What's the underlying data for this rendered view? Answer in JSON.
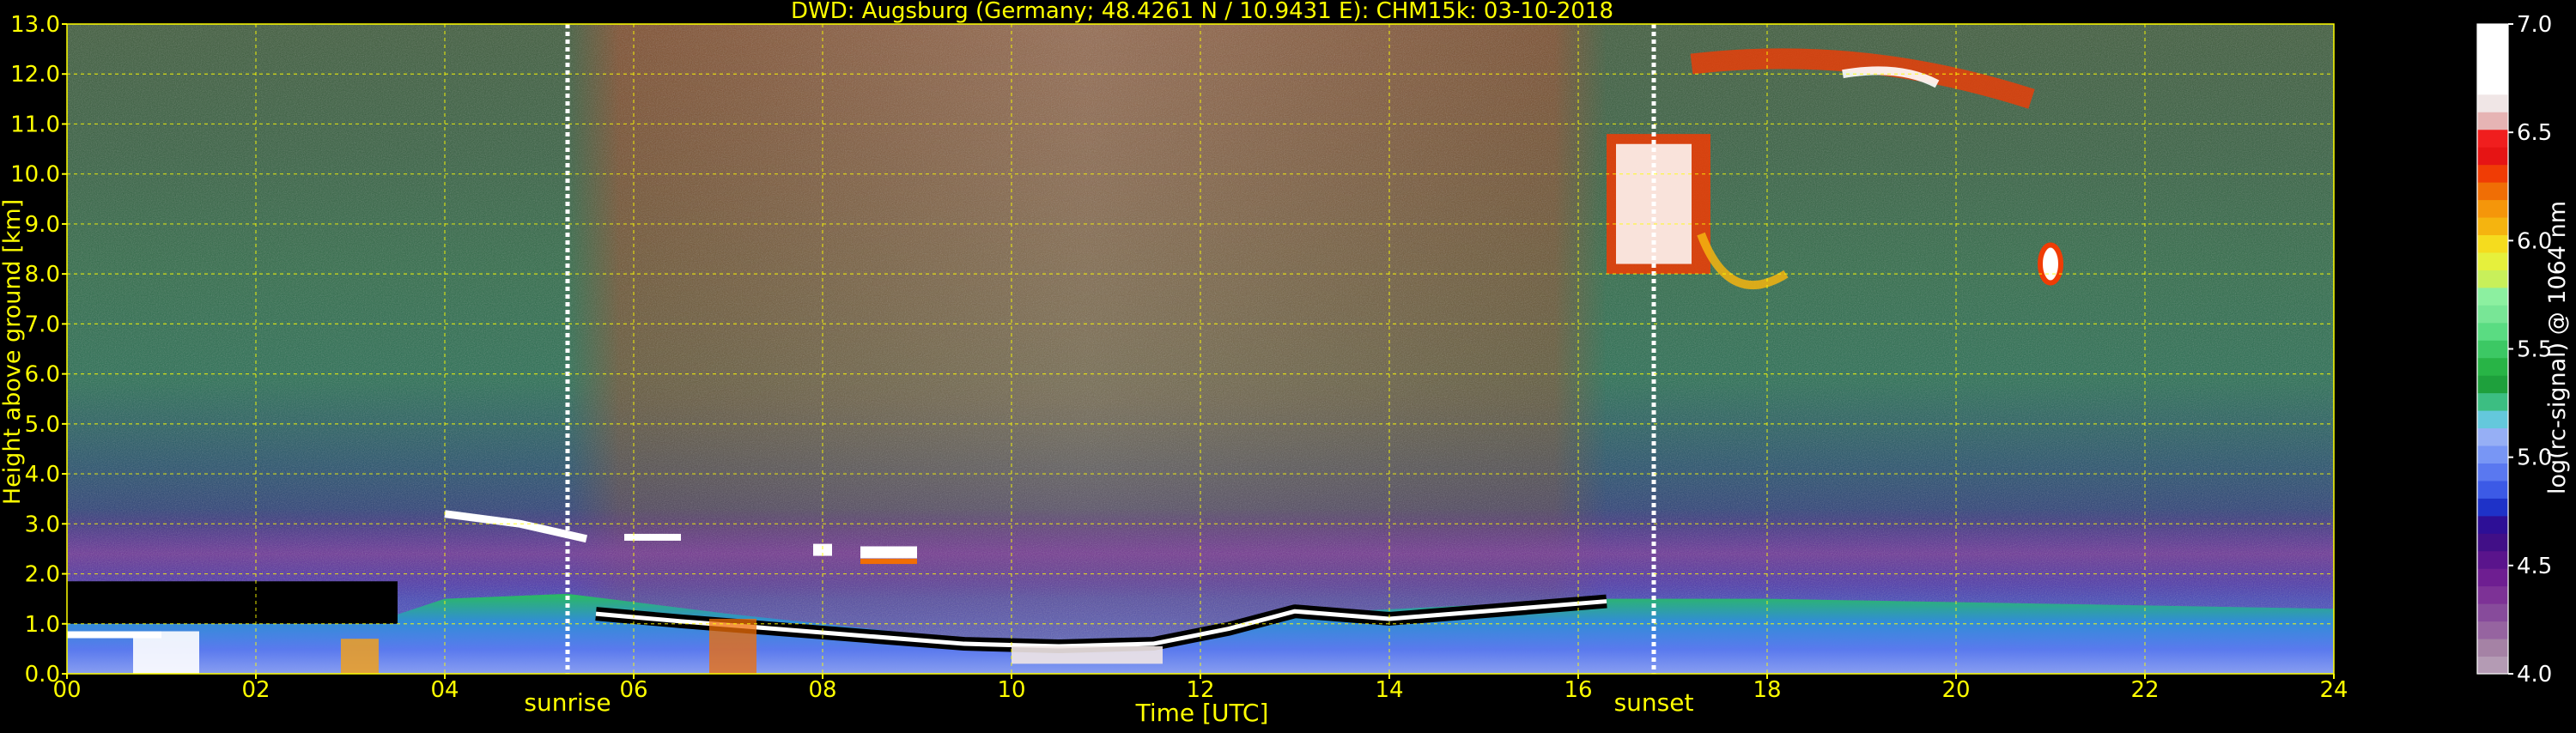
{
  "chart_data": {
    "type": "heatmap",
    "title": "DWD: Augsburg (Germany; 48.4261 N / 10.9431 E):    CHM15k: 03-10-2018",
    "xlabel": "Time [UTC]",
    "ylabel": "Height above ground [km]",
    "xlim": [
      0,
      24
    ],
    "ylim": [
      0,
      13
    ],
    "x_ticks": [
      "00",
      "02",
      "04",
      "06",
      "08",
      "10",
      "12",
      "14",
      "16",
      "18",
      "20",
      "22",
      "24"
    ],
    "y_ticks": [
      "0.0",
      "1.0",
      "2.0",
      "3.0",
      "4.0",
      "5.0",
      "6.0",
      "7.0",
      "8.0",
      "9.0",
      "10.0",
      "11.0",
      "12.0",
      "13.0"
    ],
    "grid": true,
    "markers": [
      {
        "label": "sunrise",
        "x": 5.3
      },
      {
        "label": "sunset",
        "x": 16.8
      }
    ],
    "colorbar": {
      "label": "log(rc-signal) @ 1064 nm",
      "range": [
        4.0,
        7.0
      ],
      "ticks": [
        "4.0",
        "4.5",
        "5.0",
        "5.5",
        "6.0",
        "6.5",
        "7.0"
      ],
      "colors": [
        "#b49bb4",
        "#a582a5",
        "#9664a0",
        "#874b9b",
        "#7d3296",
        "#6e1e91",
        "#5a148c",
        "#410f87",
        "#2d0f96",
        "#1e32c8",
        "#3c5ae6",
        "#5a78f0",
        "#7896f5",
        "#96aff5",
        "#64c8dc",
        "#3cbe82",
        "#1ea03c",
        "#28b446",
        "#3cc864",
        "#5adc82",
        "#78e696",
        "#8cf0a0",
        "#c8f05a",
        "#e6f03c",
        "#f5dc1e",
        "#f5b40f",
        "#f5960a",
        "#f06e05",
        "#f03c05",
        "#e61414",
        "#f01e1e",
        "#e6b4b4",
        "#f0e6e6",
        "#ffffff",
        "#ffffff",
        "#ffffff",
        "#ffffff"
      ]
    },
    "features": [
      {
        "name": "boundary layer aerosol",
        "x": [
          0,
          24
        ],
        "y": [
          0,
          1.6
        ]
      },
      {
        "name": "elevated aerosol layer",
        "x": [
          4.0,
          5.5
        ],
        "y": [
          2.5,
          3.2
        ]
      },
      {
        "name": "boundary layer top",
        "x": [
          5.5,
          16.3
        ],
        "y": [
          0.5,
          1.5
        ]
      },
      {
        "name": "cirrus",
        "x": [
          16.3,
          19.5
        ],
        "y": [
          8.0,
          10.8
        ]
      },
      {
        "name": "cirrus",
        "x": [
          17.2,
          20.8
        ],
        "y": [
          11.3,
          12.5
        ]
      },
      {
        "name": "cirrus",
        "x": [
          20.8,
          21.2
        ],
        "y": [
          7.8,
          8.6
        ]
      }
    ]
  }
}
